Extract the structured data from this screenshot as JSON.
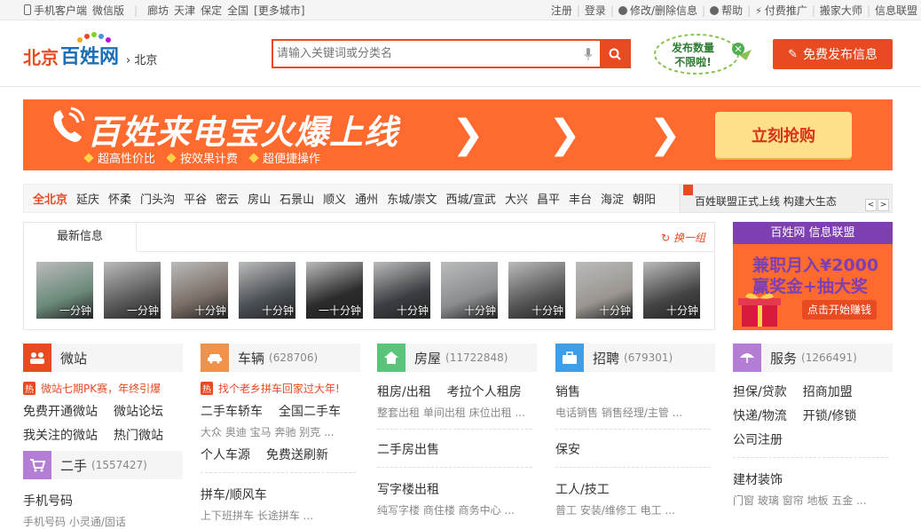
{
  "topbar": {
    "left": [
      "手机客户端",
      "微信版",
      "廊坊",
      "天津",
      "保定",
      "全国",
      "[更多城市]"
    ],
    "right": [
      "注册",
      "登录",
      "修改/删除信息",
      "帮助",
      "付费推广",
      "搬家大师",
      "信息联盟"
    ]
  },
  "header": {
    "logo_city": "北京",
    "logo_brand": "百姓网",
    "current_city": "北京",
    "search_placeholder": "请输入关键词或分类名",
    "bubble_text_1": "发布数量",
    "bubble_text_2": "不限啦!",
    "publish_button": "免费发布信息"
  },
  "banner": {
    "title": "百姓来电宝火爆上线",
    "features": [
      "超高性价比",
      "按效果计费",
      "超便捷操作"
    ],
    "buy_button": "立刻抢购"
  },
  "districts": [
    "全北京",
    "延庆",
    "怀柔",
    "门头沟",
    "平谷",
    "密云",
    "房山",
    "石景山",
    "顺义",
    "通州",
    "东城/崇文",
    "西城/宣武",
    "大兴",
    "昌平",
    "丰台",
    "海淀",
    "朝阳"
  ],
  "notice": {
    "text": "百姓联盟正式上线 构建大生态",
    "prev": "<",
    "next": ">"
  },
  "latest": {
    "tab": "最新信息",
    "change": "换一组",
    "thumbs": [
      "一分钟",
      "一分钟",
      "十分钟",
      "十分钟",
      "一十分钟",
      "十分钟",
      "十分钟",
      "十分钟",
      "十分钟",
      "十分钟"
    ]
  },
  "ad": {
    "header": "百姓网 信息联盟",
    "line1": "兼职月入¥2000",
    "line2": "赢奖金+抽大奖",
    "cta": "点击开始赚钱"
  },
  "categories": {
    "weizhan": {
      "name": "微站",
      "hot": "微站七期PK赛，年终引爆",
      "row1": [
        "免费开通微站",
        "微站论坛"
      ],
      "row2": [
        "我关注的微站",
        "热门微站"
      ]
    },
    "ershou": {
      "name": "二手",
      "count": "(1557427)",
      "row1": [
        "手机号码"
      ],
      "sub1": "手机号码 小灵通/固话"
    },
    "cheliang": {
      "name": "车辆",
      "count": "(628706)",
      "hot": "找个老乡拼车回家过大年!",
      "row1": [
        "二手车轿车",
        "全国二手车"
      ],
      "sub1": "大众 奥迪 宝马 奔驰 别克 ...",
      "row2": [
        "个人车源",
        "免费送刷新"
      ],
      "row3": [
        "拼车/顺风车"
      ],
      "sub3": "上下班拼车 长途拼车 ..."
    },
    "fangwu": {
      "name": "房屋",
      "count": "(11722848)",
      "row1": [
        "租房/出租",
        "考拉个人租房"
      ],
      "sub1": "整套出租 单间出租 床位出租 ...",
      "row2": [
        "二手房出售"
      ],
      "row3": [
        "写字楼出租"
      ],
      "sub3": "纯写字楼 商住楼 商务中心 ..."
    },
    "zhaopin": {
      "name": "招聘",
      "count": "(679301)",
      "row1": [
        "销售"
      ],
      "sub1": "电话销售 销售经理/主管 ...",
      "row2": [
        "保安"
      ],
      "row3": [
        "工人/技工"
      ],
      "sub3": "普工 安装/维修工 电工 ..."
    },
    "fuwu": {
      "name": "服务",
      "count": "(1266491)",
      "row1": [
        "担保/贷款",
        "招商加盟"
      ],
      "row2": [
        "快递/物流",
        "开锁/修锁"
      ],
      "row3": [
        "公司注册"
      ],
      "row4": [
        "建材装饰"
      ],
      "sub4": "门窗 玻璃 窗帘 地板 五金 ..."
    }
  },
  "colors": {
    "accent": "#e84a22",
    "brand_blue": "#1c6fb6",
    "banner": "#ff6a2e",
    "purple": "#7d3fb1"
  }
}
